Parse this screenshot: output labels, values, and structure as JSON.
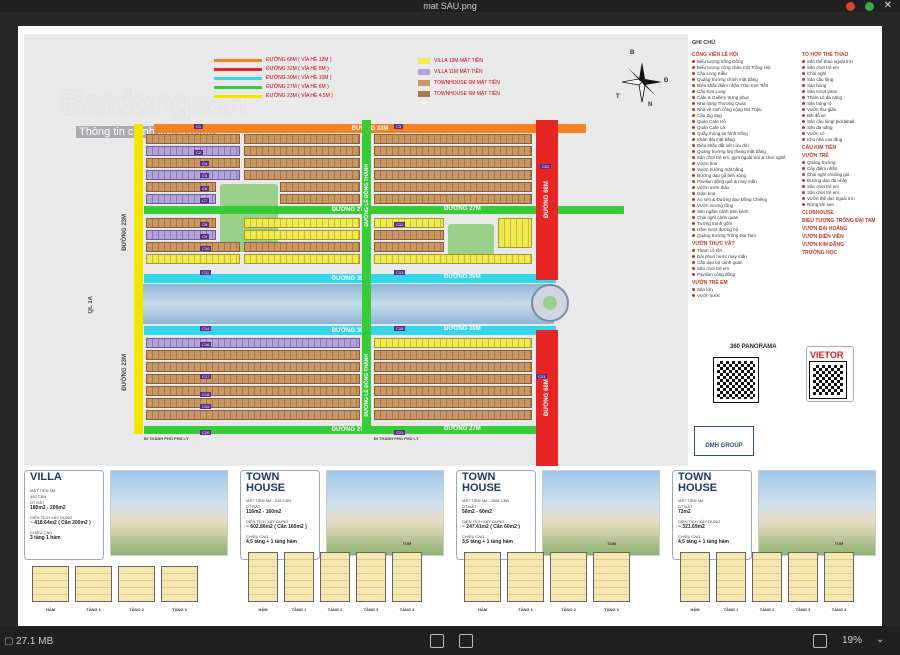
{
  "window": {
    "title": "mat SAU.png"
  },
  "status": {
    "file_size": "27.1 MB",
    "zoom": "19%"
  },
  "image": {
    "watermark": "Batdongsan",
    "watermark_sub": "Thông tin chính xác liên tục",
    "road_legend": [
      {
        "label": "ĐƯỜNG 68M ( VỈA HÈ 12M )",
        "color": "#f58220"
      },
      {
        "label": "ĐƯỜNG 32M ( VỈA HÈ 5M )",
        "color": "#e62525"
      },
      {
        "label": "ĐƯỜNG 30M ( VỈA HÈ 10M )",
        "color": "#33d7ec"
      },
      {
        "label": "ĐƯỜNG 27M ( VỈA HÈ 6M )",
        "color": "#39cc39"
      },
      {
        "label": "ĐƯỜNG 23M ( VỈA HÈ 4,5M )",
        "color": "#f2e600"
      }
    ],
    "type_legend": [
      {
        "label": "VILLA 13M MẶT TIỀN",
        "color": "#efea52"
      },
      {
        "label": "VILLA 11M MẶT TIỀN",
        "color": "#b4a3d8"
      },
      {
        "label": "TOWNHOUSE 6M MẶT TIỀN",
        "color": "#c99763"
      },
      {
        "label": "TOWNHOUSE 5M MẶT TIỀN",
        "color": "#a8774a"
      }
    ],
    "roads": {
      "r33m": "ĐƯỜNG 33M",
      "r27m_a": "ĐƯỜNG 27M",
      "r27m_b": "ĐƯỜNG 27M",
      "r30m_a": "ĐƯỜNG 30M",
      "r30m_b": "ĐƯỜNG 30M",
      "r30m_c": "ĐƯỜNG 30M",
      "r30m_d": "ĐƯỜNG 30M",
      "r27m_c": "ĐƯỜNG 27M",
      "r27m_d": "ĐƯỜNG 27M",
      "r68m_a": "ĐƯỜNG 68M",
      "r68m_b": "ĐƯỜNG 68M",
      "r23m_a": "ĐƯỜNG 23M",
      "r23m_b": "ĐƯỜNG 23M",
      "le_dong_thanh_a": "ĐƯỜNG LÊ ĐÔNG THÀNH",
      "le_dong_thanh_b": "ĐƯỜNG LÊ ĐÔNG THÀNH",
      "ql1a": "QL 1A",
      "phu_ly_a": "ĐI THÀNH PHỐ PHỦ LÝ",
      "phu_ly_b": "ĐI THÀNH PHỐ PHỦ LÝ"
    },
    "block_labels": [
      "C1",
      "C2",
      "C3",
      "C4",
      "C5",
      "C6",
      "C7",
      "C8",
      "C9",
      "C10",
      "C11",
      "C12",
      "C13",
      "C14",
      "C15",
      "C16",
      "C17",
      "C18",
      "C19",
      "C20",
      "C21",
      "C22",
      "C23"
    ],
    "compass": {
      "n": "N",
      "b": "B",
      "t": "T",
      "d": "Đ"
    },
    "legend": {
      "title": "GHI CHÚ",
      "col1": [
        {
          "head": "CÔNG VIÊN LỄ HỘI",
          "items": [
            "Biểu tượng trống Đồng",
            "Biểu tượng cổng chào Cột Trống Hội",
            "Cầu Long Kiều",
            "Quảng trường chính mặt bằng",
            "Điêu khắc điểm nhấn Trâu Kim Tiền",
            "Cầu Kim Long",
            "Cafe & Gallery trưng phục",
            "Nhà hàng Thương Quán",
            "Nhà vệ sinh công cộng Mỏ Triệu",
            "Cầu Zig Zag",
            "Quán Cafe Hồ",
            "Quán Cafe Lá",
            "Quầy thông tin hình trống",
            "Khán đài mặt bằng",
            "Điêu khắc đất sét Lửu đời",
            "Quảng trường lớp thang mặt bằng",
            "Sân chơi trẻ em, gym ngoài trời & chơi nghề",
            "Vườn hoa",
            "Vườn nướng mặt bằng",
            "Đường dạo gỗ bên sông",
            "Pavilion đồng quê & may mắn",
            "Vườn ươm thảo",
            "Giàn hoa",
            "Ao sen & Đường dạo Đồng Chiêng",
            "Vườn xương rồng",
            "Sân ngắm cảnh trên kênh",
            "Chòi nghỉ cảnh quan",
            "Tường tranh gốm",
            "Hầm vượt đường bộ",
            "Quảng trường Trống Đại Tam"
          ]
        },
        {
          "head": "VƯỜN THỰC VẬT",
          "items": [
            "Tham cô tốn",
            "Đài phun nước may mắn",
            "Cầu dạo bộ cảnh quan",
            "Sân chơi trẻ em",
            "Pavilion công đồng"
          ]
        },
        {
          "head": "VƯỜN TRẺ EM",
          "items": [
            "Sân lớn",
            "Vườn nước"
          ]
        }
      ],
      "col2": [
        {
          "head": "TỔ HỢP THỂ THAO",
          "items": [
            "Sân thể thao ngoài trời",
            "Sân chơi trẻ em",
            "Chòi nghỉ",
            "Sân cầu lông",
            "Sân bóng",
            "Sân trượt patin",
            "Thảm cỏ đa năng",
            "Sân bóng rổ",
            "Vườn thư giãn",
            "Bãi đỗ xe",
            "Sân cầu lông/ pickleball",
            "Sân đa năng",
            "Vườn cỏ"
          ]
        },
        {
          "head": "",
          "items": [
            "Khu nhà cao tầng"
          ]
        },
        {
          "head": "CẦU KIM TIỀN",
          "items": []
        },
        {
          "head": "VƯỜN TRẺ",
          "items": [
            "Quảng trường",
            "Cây điểm nhấn",
            "Chòi nghỉ chuông gió",
            "Đường dạo đá nhảy",
            "Sân chơi trẻ em",
            "Sân chơi trẻ em",
            "Vườn thể dục ngoài trời",
            "Rừng khí sen"
          ]
        },
        {
          "head": "CLUBHOUSE",
          "items": []
        },
        {
          "head": "BIỂU TƯỢNG TRỐNG ĐẠI TAM",
          "items": []
        },
        {
          "head": "VƯỜN ĐẠI HOÀNG",
          "items": []
        },
        {
          "head": "VƯỜN ĐIỀN VIÊN",
          "items": []
        },
        {
          "head": "VƯỜN KIM ĐĂNG",
          "items": []
        },
        {
          "head": "TRƯỜNG HỌC",
          "items": []
        }
      ]
    },
    "panorama": "360\nPANORAMA",
    "vietor": "VIETOR",
    "dmh": "DMH GROUP",
    "cards": [
      {
        "title": "VILLA",
        "sub1": "MẶT TIỀN 9M",
        "sub2": "492 CĂN",
        "area_label": "DT ĐẤT",
        "area": "180m2 - 200m2",
        "build_label": "DIỆN TÍCH XÂY DỰNG",
        "build": "~ 418.64m2 ( Căn 200m2 )",
        "height_label": "CHIỀU CAO",
        "height": "3 tầng 1 hầm",
        "floors": [
          "HẦM",
          "TẦNG 1",
          "TẦNG 2",
          "TẦNG 3"
        ]
      },
      {
        "title": "TOWN\nHOUSE",
        "sub1": "MẶT TIỀN 8M - 245 CĂN",
        "sub2": "",
        "area_label": "DT ĐẤT",
        "area": "116m2 - 160m2",
        "build_label": "DIỆN TÍCH XÂY DỰNG",
        "build": "~ 602.86m2 ( Căn 160m2 )",
        "height_label": "CHIỀU CAO",
        "height": "4,5 tầng + 1 tầng hầm",
        "floors": [
          "HẦM",
          "TẦNG 1",
          "TẦNG 2",
          "TẦNG 3",
          "TẦNG 4"
        ],
        "tum": "TUM"
      },
      {
        "title": "TOWN\nHOUSE",
        "sub1": "MẶT TIỀN 4M - 2584 CĂN",
        "sub2": "",
        "area_label": "DT ĐẤT",
        "area": "56m2 - 60m2",
        "build_label": "DIỆN TÍCH XÂY DỰNG",
        "build": "~ 247.41m2 ( Căn 60m2 )",
        "height_label": "CHIỀU CAO",
        "height": "3,5 tầng + 1 tầng hầm",
        "floors": [
          "HẦM",
          "TẦNG 1",
          "TẦNG 2",
          "TẦNG 3"
        ],
        "tum": "TUM"
      },
      {
        "title": "TOWN\nHOUSE",
        "sub1": "MẶT TIỀN 4M",
        "sub2": "",
        "area_label": "DT ĐẤT",
        "area": "72m2",
        "build_label": "DIỆN TÍCH XÂY DỰNG",
        "build": "~ 321.69m2",
        "height_label": "CHIỀU CAO",
        "height": "4,5 tầng + 1 tầng hầm",
        "floors": [
          "HẦM",
          "TẦNG 1",
          "TẦNG 2",
          "TẦNG 3",
          "TẦNG 4"
        ],
        "tum": "TUM"
      }
    ]
  }
}
